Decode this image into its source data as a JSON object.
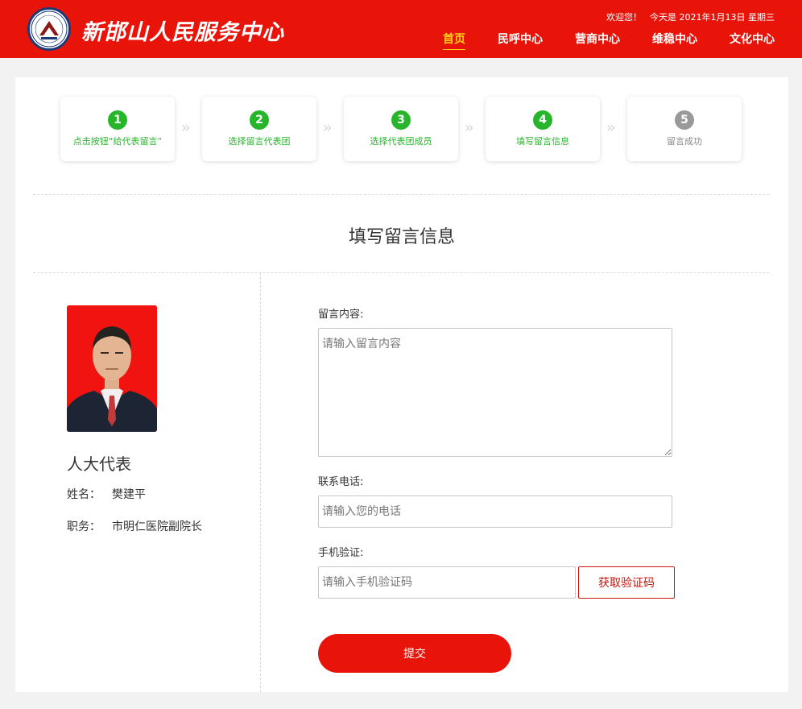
{
  "header": {
    "logo_text": "新邯山人民服务中心",
    "greeting": "欢迎您！",
    "date": "今天是 2021年1月13日 星期三",
    "nav": [
      "首页",
      "民呼中心",
      "营商中心",
      "维稳中心",
      "文化中心"
    ],
    "active_nav": "首页"
  },
  "steps": [
    {
      "num": "1",
      "label": "点击按钮“给代表留言”"
    },
    {
      "num": "2",
      "label": "选择留言代表团"
    },
    {
      "num": "3",
      "label": "选择代表团成员"
    },
    {
      "num": "4",
      "label": "填写留言信息"
    },
    {
      "num": "5",
      "label": "留言成功"
    }
  ],
  "colors": {
    "brand_red": "#e8140a",
    "step_green": "#27b52c",
    "step_gray": "#999999",
    "nav_active": "#ffd11a"
  },
  "page_title": "填写留言信息",
  "profile": {
    "role": "人大代表",
    "name_label": "姓名：",
    "name": "樊建平",
    "position_label": "职务：",
    "position": "市明仁医院副院长"
  },
  "form": {
    "content_label": "留言内容:",
    "content_placeholder": "请输入留言内容",
    "phone_label": "联系电话:",
    "phone_placeholder": "请输入您的电话",
    "code_label": "手机验证:",
    "code_placeholder": "请输入手机验证码",
    "code_button": "获取验证码",
    "submit": "提交"
  }
}
